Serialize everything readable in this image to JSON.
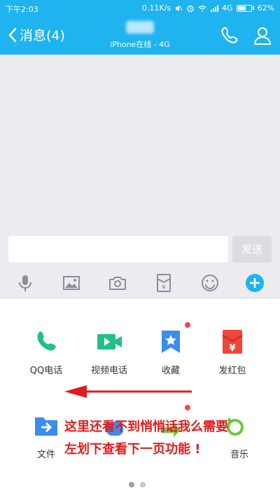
{
  "status_bar": {
    "time": "下午2:03",
    "network_speed": "0.11K/s",
    "network_type": "4G",
    "battery_percent": "62%",
    "battery_level": 0.62
  },
  "header": {
    "back_label": "消息(4)",
    "subtitle": "iPhone在线 - 4G"
  },
  "input": {
    "value": "",
    "send_label": "发送"
  },
  "toolbar": {
    "icons": [
      "microphone-icon",
      "image-icon",
      "camera-icon",
      "red-packet-icon",
      "emoji-icon",
      "plus-icon"
    ]
  },
  "panel": {
    "row1": [
      {
        "label": "QQ电话",
        "icon": "phone-icon",
        "color": "#21c08a"
      },
      {
        "label": "视频电话",
        "icon": "video-icon",
        "color": "#21c08a"
      },
      {
        "label": "收藏",
        "icon": "favorite-icon",
        "color": "#3b8ced",
        "badge": true
      },
      {
        "label": "发红包",
        "icon": "red-envelope-icon",
        "color": "#f0453a"
      }
    ],
    "row2": [
      {
        "label": "文件",
        "icon": "folder-icon",
        "color": "#3b8ced"
      },
      {
        "label": "音乐",
        "icon": "music-icon",
        "color": "#6bc83d"
      }
    ]
  },
  "annotation": {
    "line1": "这里还看不到悄悄话我么需要",
    "line2": "左划下查看下一页功能 !"
  },
  "pager": {
    "pages": 2,
    "current": 1
  },
  "colors": {
    "accent": "#1fb3f0",
    "chat_bg": "#ebebf0",
    "annotation_red": "#e31b1b",
    "badge_red": "#f44a3a"
  }
}
